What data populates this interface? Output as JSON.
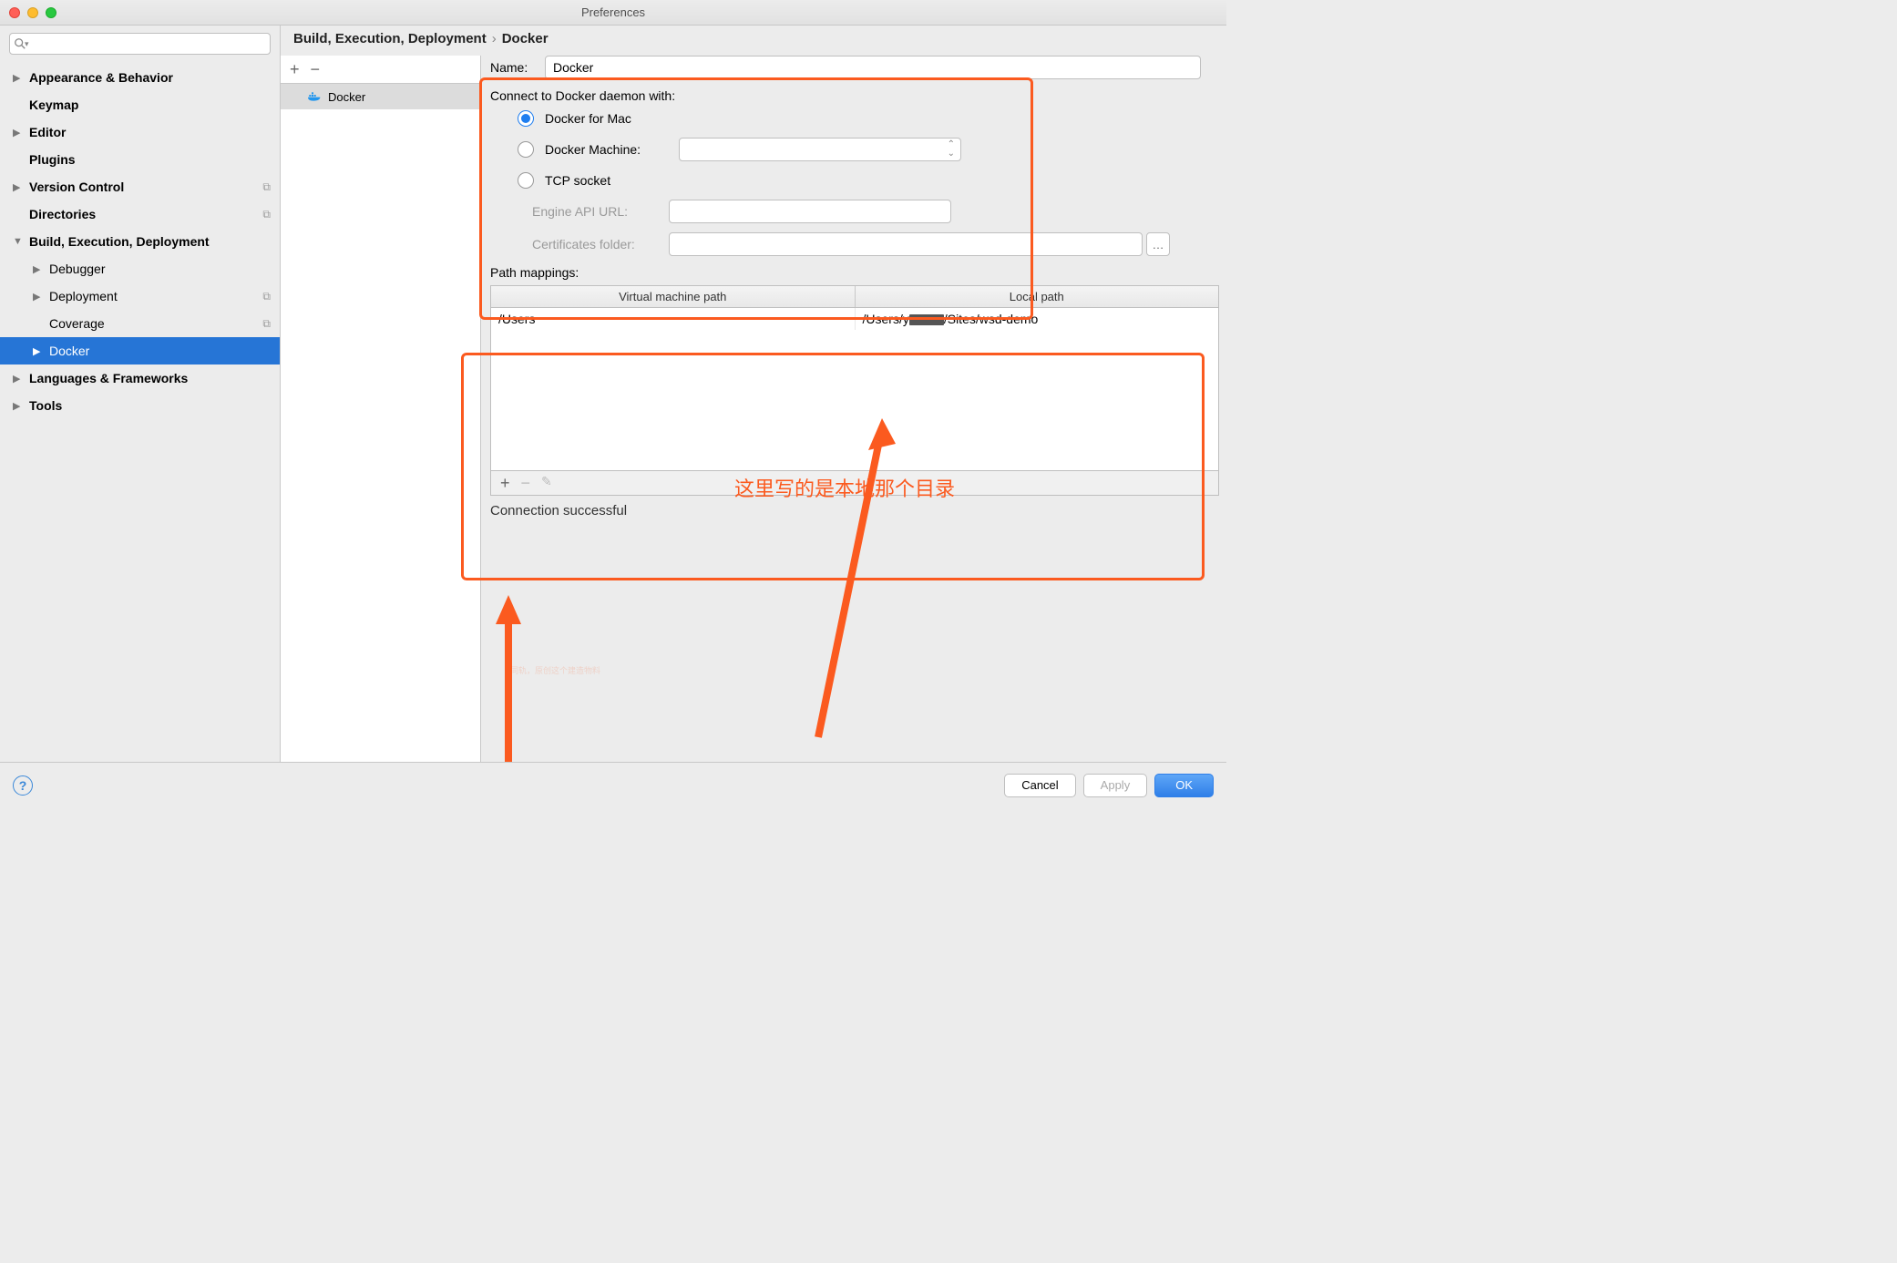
{
  "window": {
    "title": "Preferences"
  },
  "search": {
    "placeholder": ""
  },
  "sidebar": {
    "items": [
      {
        "label": "Appearance & Behavior",
        "bold": true,
        "arrow": "▶"
      },
      {
        "label": "Keymap",
        "bold": true,
        "arrow": ""
      },
      {
        "label": "Editor",
        "bold": true,
        "arrow": "▶"
      },
      {
        "label": "Plugins",
        "bold": true,
        "arrow": ""
      },
      {
        "label": "Version Control",
        "bold": true,
        "arrow": "▶",
        "copy": true
      },
      {
        "label": "Directories",
        "bold": true,
        "arrow": "",
        "copy": true
      },
      {
        "label": "Build, Execution, Deployment",
        "bold": true,
        "arrow": "▼"
      },
      {
        "label": "Debugger",
        "child": true,
        "arrow": "▶"
      },
      {
        "label": "Deployment",
        "child": true,
        "arrow": "▶",
        "copy": true
      },
      {
        "label": "Coverage",
        "child": true,
        "arrow": "",
        "copy": true
      },
      {
        "label": "Docker",
        "child": true,
        "arrow": "▶",
        "selected": true
      },
      {
        "label": "Languages & Frameworks",
        "bold": true,
        "arrow": "▶"
      },
      {
        "label": "Tools",
        "bold": true,
        "arrow": "▶"
      }
    ]
  },
  "breadcrumb": {
    "parent": "Build, Execution, Deployment",
    "sep": "›",
    "current": "Docker"
  },
  "center": {
    "item": "Docker"
  },
  "form": {
    "name_label": "Name:",
    "name_value": "Docker",
    "connect_label": "Connect to Docker daemon with:",
    "radios": {
      "mac": "Docker for Mac",
      "machine": "Docker Machine:",
      "tcp": "TCP socket"
    },
    "engine_url_label": "Engine API URL:",
    "cert_label": "Certificates folder:",
    "path_label": "Path mappings:",
    "path_headers": {
      "vm": "Virtual machine path",
      "local": "Local path"
    },
    "path_row": {
      "vm": "/Users",
      "local_pre": "/Users/y",
      "local_post": "/Sites/wsd-demo"
    },
    "status": "Connection successful"
  },
  "footer": {
    "cancel": "Cancel",
    "apply": "Apply",
    "ok": "OK"
  },
  "annotations": {
    "text1": "这里写的是本地那个目录"
  },
  "colors": {
    "accent": "#2675d6",
    "anno": "#fb5a1f"
  }
}
